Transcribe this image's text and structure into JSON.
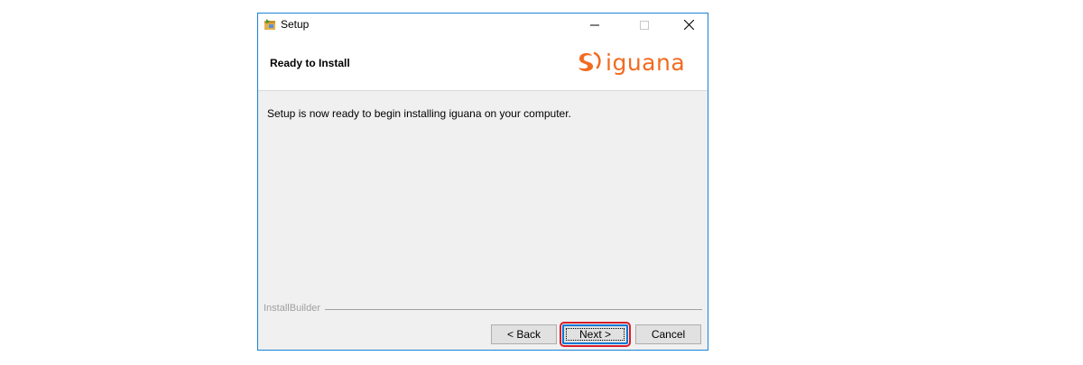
{
  "window": {
    "title": "Setup",
    "controls": {
      "minimize": "minimize-icon",
      "maximize": "maximize-icon",
      "close": "close-icon"
    }
  },
  "header": {
    "title": "Ready to Install",
    "logo_text": "iguana",
    "logo_color": "#f26b21"
  },
  "main": {
    "message": "Setup is now ready to begin installing iguana on your computer."
  },
  "footer": {
    "brand": "InstallBuilder",
    "back_label": "< Back",
    "next_label": "Next >",
    "cancel_label": "Cancel"
  },
  "colors": {
    "accent": "#0078d7",
    "highlight": "#d81e2a"
  }
}
